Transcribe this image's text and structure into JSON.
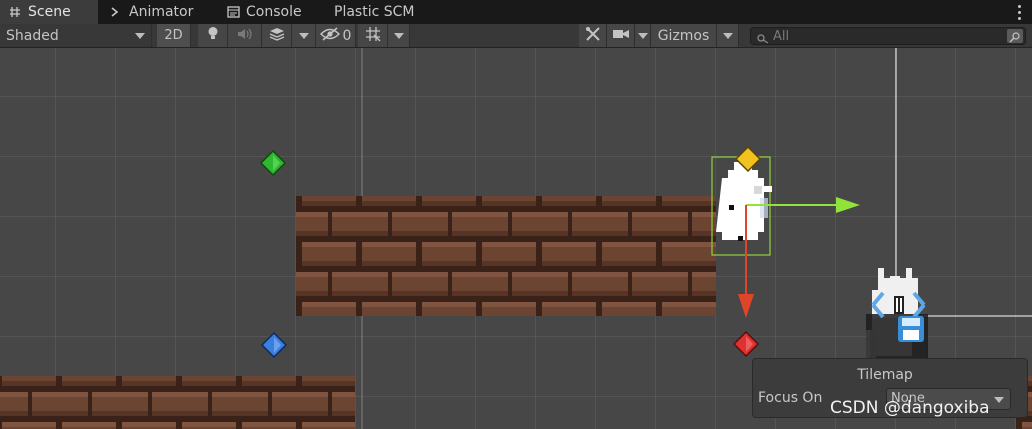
{
  "tabs": [
    {
      "label": "Scene",
      "icon": "hash-icon"
    },
    {
      "label": "Animator",
      "icon": "animator-icon"
    },
    {
      "label": "Console",
      "icon": "console-icon"
    },
    {
      "label": "Plastic SCM",
      "icon": ""
    }
  ],
  "toolbar": {
    "shading_mode": "Shaded",
    "mode_2d": "2D",
    "hidden_count": "0",
    "gizmos": "Gizmos",
    "search_placeholder": "All"
  },
  "tilemap_overlay": {
    "title": "Tilemap",
    "focus_label": "Focus On",
    "focus_value": "None"
  },
  "watermark": "CSDN @dangoxiba",
  "colors": {
    "tab_bar": "#191919",
    "toolbar": "#383838",
    "scene_bg": "#474747",
    "brick": "#6b4432",
    "gizmo_x": "#8fe33a",
    "gizmo_y": "#e0452a"
  }
}
